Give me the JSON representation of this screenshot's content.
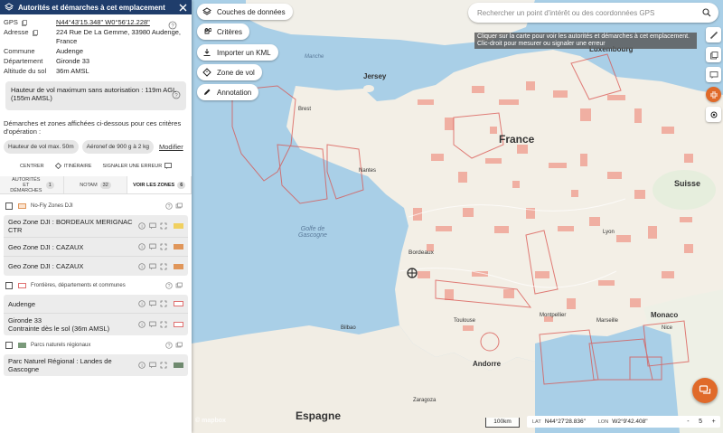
{
  "panel": {
    "title": "Autorités et démarches à cet emplacement",
    "info": {
      "gps_label": "GPS",
      "gps_value": "N44°43'15.348\" W0°56'12.228\"",
      "address_label": "Adresse",
      "address_value": "224 Rue De La Gemme, 33980 Audenge, France",
      "commune_label": "Commune",
      "commune_value": "Audenge",
      "departement_label": "Département",
      "departement_value": "Gironde 33",
      "altitude_label": "Altitude du sol",
      "altitude_value": "36m AMSL"
    },
    "height_box": "Hauteur de vol maximum sans autorisation : 119m AGL (155m AMSL)",
    "criteria_text": "Démarches et zones affichées ci-dessous pour ces critères d'opération :",
    "chips": [
      "Hauteur de vol max. 50m",
      "Aéronef de 900 g à 2 kg"
    ],
    "modify_label": "Modifier",
    "actions": [
      "CENTRER",
      "ITINÉRAIRE",
      "SIGNALER UNE ERREUR"
    ],
    "tabs": [
      {
        "label": "AUTORITÉS ET DÉMARCHES",
        "count": "1"
      },
      {
        "label": "NOTAM",
        "count": "32"
      },
      {
        "label": "VOIR LES ZONES",
        "count": "6"
      }
    ],
    "groups": [
      {
        "label": "No-Fly Zones DJI",
        "color": "#e0965a",
        "zones": [
          {
            "name": "Geo Zone DJI : BORDEAUX MERIGNAC CTR",
            "color": "#f0d060"
          },
          {
            "name": "Geo Zone DJI : CAZAUX",
            "color": "#e0965a"
          },
          {
            "name": "Geo Zone DJI : CAZAUX",
            "color": "#e0965a"
          }
        ]
      },
      {
        "label": "Frontières, départements et communes",
        "color": "#e07070",
        "zones": [
          {
            "name": "Audenge",
            "color": "#e07070"
          },
          {
            "name": "Gironde 33",
            "sub": "Contrainte dès le sol (36m AMSL)",
            "color": "#e07070"
          }
        ]
      },
      {
        "label": "Parcs naturels régionaux",
        "color": "#7a9a7a",
        "zones": [
          {
            "name": "Parc Naturel Régional : Landes de Gascogne",
            "color": "#6f8a6f"
          }
        ]
      }
    ]
  },
  "map": {
    "buttons": [
      "Couches de données",
      "Critères",
      "Importer un KML",
      "Zone de vol",
      "Annotation"
    ],
    "search_placeholder": "Rechercher un point d'intérêt ou des coordonnées GPS",
    "tooltip": "Cliquer sur la carte pour voir les autorités et démarches à cet emplacement. Clic-droit pour mesurer ou signaler une erreur",
    "scale": "100km",
    "coords": {
      "lat_label": "LAT",
      "lat_value": "N44°27'28.836\"",
      "lon_label": "LON",
      "lon_value": "W2°9'42.408\""
    },
    "zoom": {
      "minus": "-",
      "value": "5",
      "plus": "+"
    },
    "labels": {
      "jersey": "Jersey",
      "luxembourg": "Luxembourg",
      "france": "France",
      "suisse": "Suisse",
      "golfe": "Golfe de Gascogne",
      "bordeaux": "Bordeaux",
      "monaco": "Monaco",
      "montpellier": "Montpellier",
      "marseille": "Marseille",
      "andorre": "Andorre",
      "espagne": "Espagne",
      "bilbao": "Bilbao",
      "zaragoza": "Zaragoza",
      "manche": "Manche",
      "brest": "Brest",
      "nantes": "Nantes",
      "lyon": "Lyon",
      "toulouse": "Toulouse",
      "nice": "Nice",
      "mapbox": "© mapbox"
    }
  }
}
